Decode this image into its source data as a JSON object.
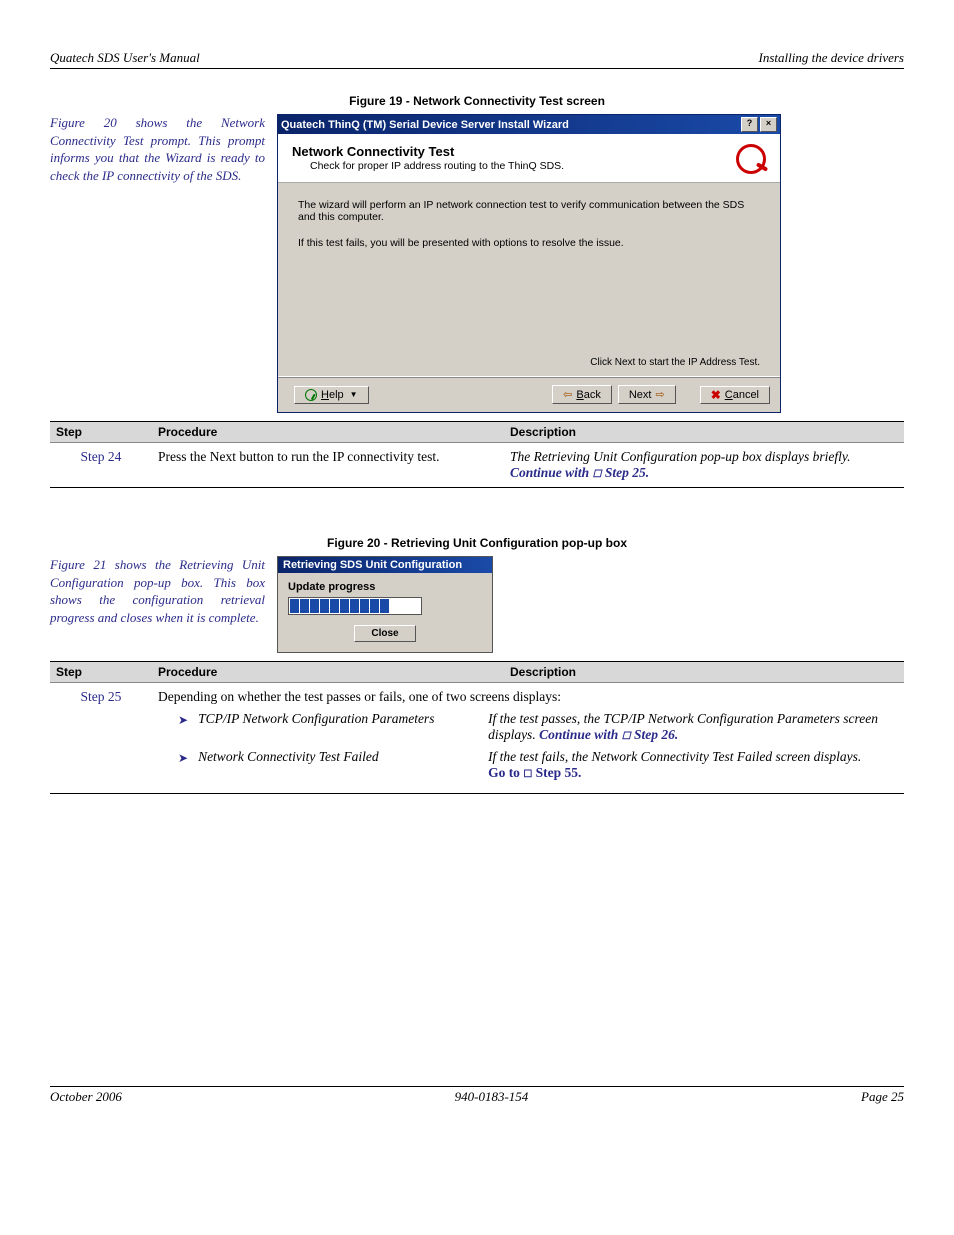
{
  "header": {
    "left": "Quatech SDS User's Manual",
    "right": "Installing the device drivers"
  },
  "footer": {
    "left": "October 2006",
    "center": "940-0183-154",
    "right": "Page 25"
  },
  "fig19": {
    "caption": "Figure 19 - Network Connectivity Test screen",
    "sidetext": "Figure 20 shows the Network Connectivity Test prompt. This prompt informs you that the Wizard is ready to check the IP connectivity of the SDS."
  },
  "wizard": {
    "title": "Quatech ThinQ (TM) Serial Device Server Install Wizard",
    "heading": "Network Connectivity Test",
    "subheading": "Check for proper IP address routing to the ThinQ SDS.",
    "body1": "The wizard will perform an IP network connection test to verify communication between the SDS and this computer.",
    "body2": "If this test fails, you will be presented with options to resolve the issue.",
    "hint": "Click Next to start the IP Address Test.",
    "help": "Help",
    "back": "Back",
    "next": "Next",
    "cancel": "Cancel"
  },
  "table1": {
    "headers": {
      "step": "Step",
      "proc": "Procedure",
      "desc": "Description"
    },
    "row": {
      "label": "Step 24",
      "proc": "Press the Next button to run the IP connectivity test.",
      "desc1": "The Retrieving Unit Configuration pop-up box displays briefly.",
      "desc2a": "Continue with ",
      "desc2b": " Step 25."
    }
  },
  "fig20": {
    "caption": "Figure 20 - Retrieving Unit Configuration pop-up box",
    "sidetext": "Figure 21 shows the Retrieving Unit Configuration pop-up box. This box shows the configuration retrieval progress and closes when it is complete."
  },
  "popup": {
    "title": "Retrieving SDS Unit Configuration",
    "label": "Update progress",
    "close": "Close"
  },
  "table2": {
    "row": {
      "label": "Step 25",
      "proc": "Depending on whether the test passes or fails, one of two screens displays:",
      "b1": "TCP/IP Network Configuration Parameters",
      "d1a": "If the test passes, the TCP/IP Network Configuration Parameters screen displays. ",
      "d1b": "Continue with ",
      "d1c": " Step 26.",
      "b2": "Network Connectivity Test Failed",
      "d2a": "If the test fails, the Network Connectivity Test Failed screen displays.",
      "d2b": "Go to ",
      "d2c": " Step 55."
    }
  }
}
